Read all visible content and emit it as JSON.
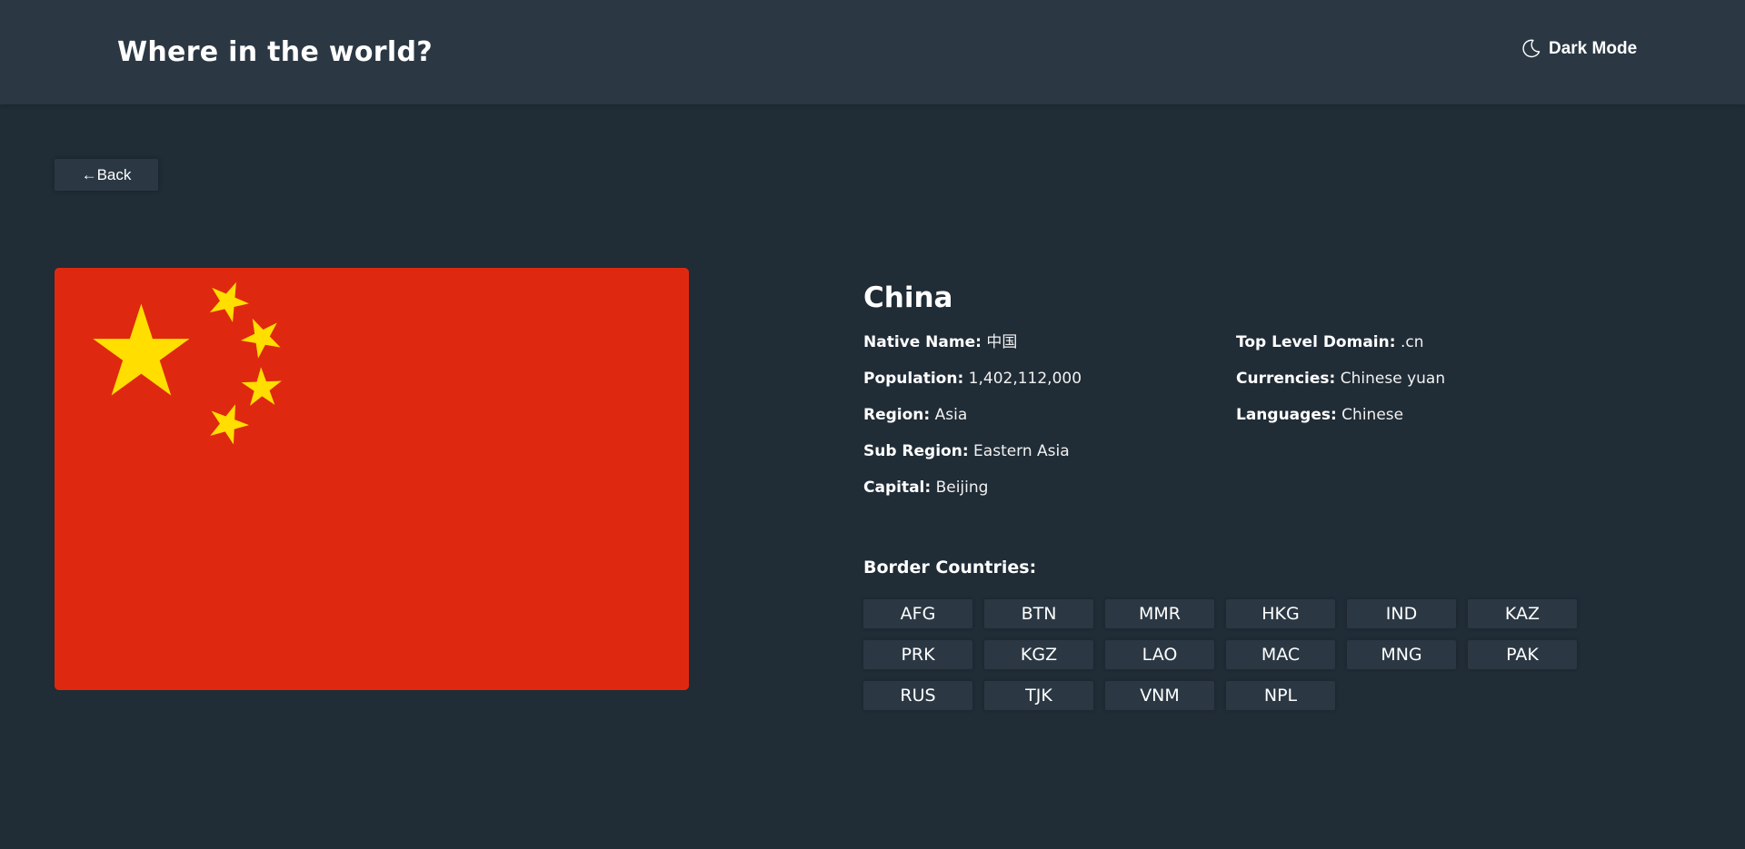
{
  "header": {
    "title": "Where in the world?",
    "theme_toggle_label": "Dark Mode",
    "theme_icon": "moon-icon"
  },
  "back_button": {
    "label": "←Back"
  },
  "flag": {
    "icon": "china-flag",
    "colors": {
      "field": "#de2910",
      "stars": "#ffde00"
    }
  },
  "country": {
    "name": "China",
    "left_details": [
      {
        "key": "Native Name:",
        "value": "中国"
      },
      {
        "key": "Population:",
        "value": "1,402,112,000"
      },
      {
        "key": "Region:",
        "value": "Asia"
      },
      {
        "key": "Sub Region:",
        "value": "Eastern Asia"
      },
      {
        "key": "Capital:",
        "value": "Beijing"
      }
    ],
    "right_details": [
      {
        "key": "Top Level Domain:",
        "value": ".cn"
      },
      {
        "key": "Currencies:",
        "value": "Chinese yuan"
      },
      {
        "key": "Languages:",
        "value": "Chinese"
      }
    ]
  },
  "border_countries": {
    "label": "Border Countries:",
    "items": [
      "AFG",
      "BTN",
      "MMR",
      "HKG",
      "IND",
      "KAZ",
      "PRK",
      "KGZ",
      "LAO",
      "MAC",
      "MNG",
      "PAK",
      "RUS",
      "TJK",
      "VNM",
      "NPL"
    ]
  },
  "colors": {
    "background": "#202c36",
    "elements": "#2b3844",
    "text": "#ffffff"
  }
}
